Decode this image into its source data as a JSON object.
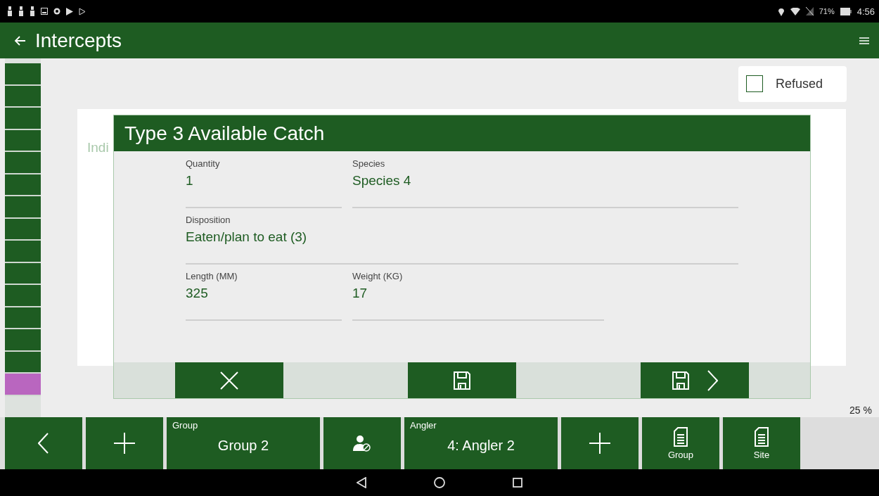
{
  "status_bar": {
    "battery": "71%",
    "time": "4:56"
  },
  "app_bar": {
    "title": "Intercepts"
  },
  "strip": [
    {
      "color": "#1e5c22"
    },
    {
      "color": "#1e5c22"
    },
    {
      "color": "#1e5c22"
    },
    {
      "color": "#1e5c22"
    },
    {
      "color": "#1e5c22"
    },
    {
      "color": "#1e5c22"
    },
    {
      "color": "#1e5c22"
    },
    {
      "color": "#1e5c22"
    },
    {
      "color": "#1e5c22"
    },
    {
      "color": "#1e5c22"
    },
    {
      "color": "#1e5c22"
    },
    {
      "color": "#1e5c22"
    },
    {
      "color": "#1e5c22"
    },
    {
      "color": "#1e5c22"
    },
    {
      "color": "#b966bf"
    }
  ],
  "refused": {
    "label": "Refused",
    "checked": false
  },
  "background_text": "Indi",
  "dialog": {
    "title": "Type 3 Available Catch",
    "rows": [
      [
        {
          "kind": "narrow",
          "label": "Quantity",
          "value": "1"
        },
        {
          "kind": "wide",
          "label": "Species",
          "value": "Species 4"
        }
      ],
      [
        {
          "kind": "full",
          "label": "Disposition",
          "value": "Eaten/plan to eat (3)"
        }
      ],
      [
        {
          "kind": "narrow",
          "label": "Length (MM)",
          "value": "325"
        },
        {
          "kind": "medium",
          "label": "Weight (KG)",
          "value": "17"
        }
      ]
    ],
    "actions": [
      {
        "kind": "cancel"
      },
      {
        "kind": "save"
      },
      {
        "kind": "save-next"
      }
    ]
  },
  "progress": "25 %",
  "bottom_bar": [
    {
      "kind": "back"
    },
    {
      "kind": "add"
    },
    {
      "kind": "selector",
      "label": "Group",
      "value": "Group 2"
    },
    {
      "kind": "user-block"
    },
    {
      "kind": "selector",
      "label": "Angler",
      "value": "4: Angler 2"
    },
    {
      "kind": "add"
    },
    {
      "kind": "report",
      "label": "Group"
    },
    {
      "kind": "report",
      "label": "Site"
    }
  ]
}
